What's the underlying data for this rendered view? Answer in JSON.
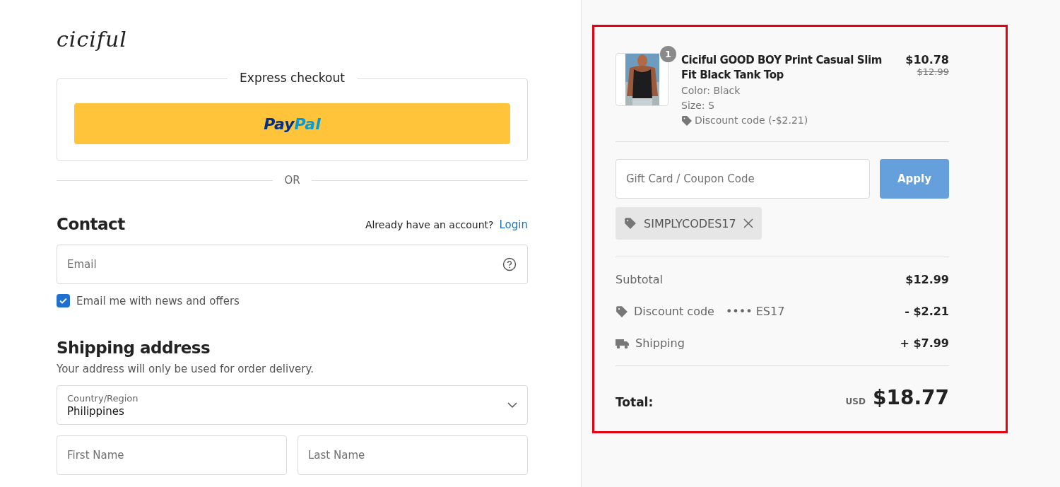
{
  "logo": "ciciful",
  "express_checkout": {
    "title": "Express checkout",
    "paypal": {
      "part_dark": "Pay",
      "part_light": "Pal"
    }
  },
  "divider_text": "OR",
  "contact": {
    "heading": "Contact",
    "account_prompt": "Already have an account?",
    "login_link": "Login",
    "email": {
      "placeholder": "Email"
    },
    "newsletter": {
      "label": "Email me with news and offers",
      "checked": true
    }
  },
  "shipping_address": {
    "heading": "Shipping address",
    "note": "Your address will only be used for order delivery.",
    "country": {
      "label": "Country/Region",
      "value": "Philippines"
    },
    "first_name": {
      "placeholder": "First Name"
    },
    "last_name": {
      "placeholder": "Last Name"
    }
  },
  "order_summary": {
    "item": {
      "quantity": "1",
      "name": "Ciciful GOOD BOY Print Casual Slim Fit Black Tank Top",
      "color_label": "Color: Black",
      "size": "Size: S",
      "discount": "Discount code (-$2.21)",
      "price": "$10.78",
      "original_price": "$12.99"
    },
    "coupon": {
      "placeholder": "Gift Card / Coupon Code",
      "button": "Apply",
      "applied_code": "SIMPLYCODES17"
    },
    "lines": [
      {
        "kind": "subtotal",
        "label": "Subtotal",
        "value": "$12.99"
      },
      {
        "kind": "discount",
        "label": "Discount code",
        "code": "•••• ES17",
        "value": "- $2.21"
      },
      {
        "kind": "shipping",
        "label": "Shipping",
        "value": "+ $7.99"
      }
    ],
    "total": {
      "label": "Total:",
      "currency": "USD",
      "value": "$18.77"
    }
  }
}
